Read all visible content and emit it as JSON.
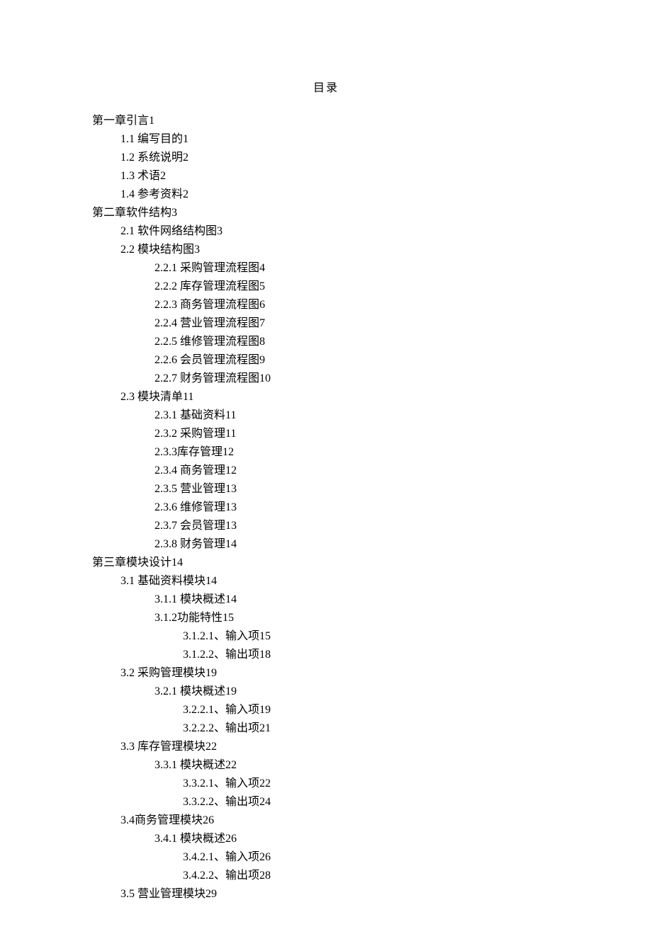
{
  "title": "目录",
  "entries": [
    {
      "level": 0,
      "text": "第一章引言1"
    },
    {
      "level": 1,
      "text": "1.1  编写目的1"
    },
    {
      "level": 1,
      "text": "1.2  系统说明2"
    },
    {
      "level": 1,
      "text": "1.3  术语2"
    },
    {
      "level": 1,
      "text": "1.4  参考资料2"
    },
    {
      "level": 0,
      "text": "第二章软件结构3"
    },
    {
      "level": 1,
      "text": "2.1  软件网络结构图3"
    },
    {
      "level": 1,
      "text": "2.2  模块结构图3"
    },
    {
      "level": 2,
      "text": "2.2.1  采购管理流程图4"
    },
    {
      "level": 2,
      "text": "2.2.2  库存管理流程图5"
    },
    {
      "level": 2,
      "text": "2.2.3  商务管理流程图6"
    },
    {
      "level": 2,
      "text": "2.2.4  营业管理流程图7"
    },
    {
      "level": 2,
      "text": "2.2.5  维修管理流程图8"
    },
    {
      "level": 2,
      "text": "2.2.6  会员管理流程图9"
    },
    {
      "level": 2,
      "text": "2.2.7 财务管理流程图10"
    },
    {
      "level": 1,
      "text": "2.3  模块清单11"
    },
    {
      "level": 2,
      "text": "2.3.1  基础资料11"
    },
    {
      "level": 2,
      "text": "2.3.2  采购管理11"
    },
    {
      "level": 2,
      "text": "2.3.3库存管理12"
    },
    {
      "level": 2,
      "text": "2.3.4  商务管理12"
    },
    {
      "level": 2,
      "text": "2.3.5  营业管理13"
    },
    {
      "level": 2,
      "text": "2.3.6  维修管理13"
    },
    {
      "level": 2,
      "text": "2.3.7  会员管理13"
    },
    {
      "level": 2,
      "text": "2.3.8  财务管理14"
    },
    {
      "level": 0,
      "text": "第三章模块设计14"
    },
    {
      "level": 1,
      "text": "3.1  基础资料模块14"
    },
    {
      "level": 2,
      "text": "3.1.1  模块概述14"
    },
    {
      "level": 2,
      "text": "3.1.2功能特性15"
    },
    {
      "level": 3,
      "text": "3.1.2.1、输入项15"
    },
    {
      "level": 3,
      "text": "3.1.2.2、输出项18"
    },
    {
      "level": 1,
      "text": "3.2  采购管理模块19"
    },
    {
      "level": 2,
      "text": "3.2.1  模块概述19"
    },
    {
      "level": 3,
      "text": "3.2.2.1、输入项19"
    },
    {
      "level": 3,
      "text": "3.2.2.2、输出项21"
    },
    {
      "level": 1,
      "text": "3.3  库存管理模块22"
    },
    {
      "level": 2,
      "text": "3.3.1  模块概述22"
    },
    {
      "level": 3,
      "text": "3.3.2.1、输入项22"
    },
    {
      "level": 3,
      "text": "3.3.2.2、输出项24"
    },
    {
      "level": 1,
      "text": "3.4商务管理模块26"
    },
    {
      "level": 2,
      "text": "3.4.1  模块概述26"
    },
    {
      "level": 3,
      "text": "3.4.2.1、输入项26"
    },
    {
      "level": 3,
      "text": "3.4.2.2、输出项28"
    },
    {
      "level": 1,
      "text": "3.5  营业管理模块29"
    }
  ]
}
